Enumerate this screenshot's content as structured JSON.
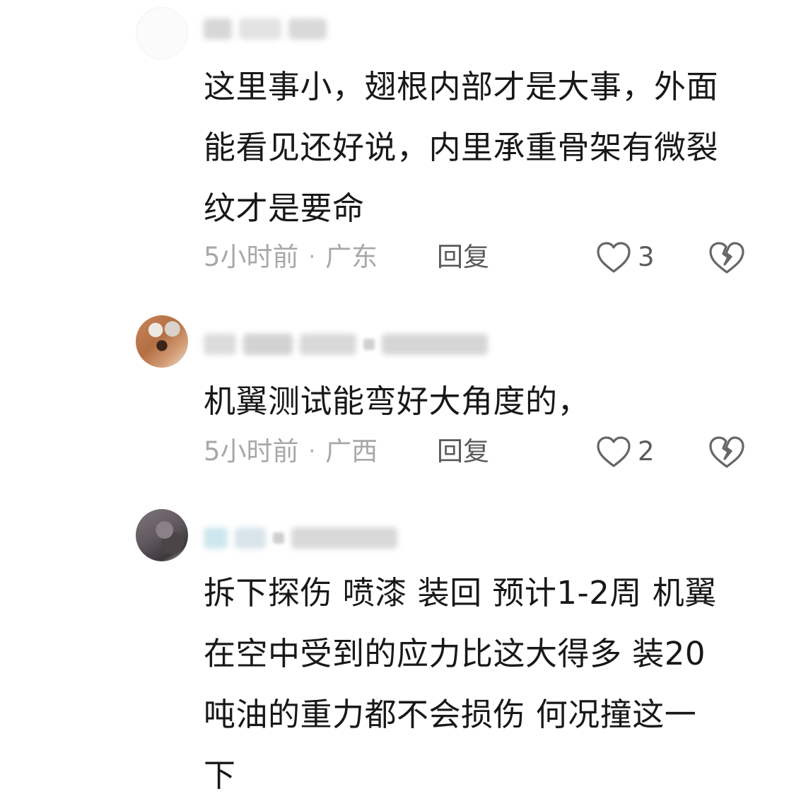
{
  "comments": [
    {
      "avatar": "blank-avatar",
      "text": "这里事小，翅根内部才是大事，外面能看见还好说，内里承重骨架有微裂纹才是要命",
      "lines": [
        "这里事小，翅根内部才是大事，外面",
        "能看见还好说，内里承重骨架有微裂",
        "纹才是要命"
      ],
      "time": "5小时前",
      "separator": "·",
      "location": "广东",
      "reply_label": "回复",
      "like_icon": "heart-outline-icon",
      "likes": "3",
      "dislike_icon": "broken-heart-icon"
    },
    {
      "avatar": "photo-avatar",
      "lines": [
        "机翼测试能弯好大角度的，"
      ],
      "time": "5小时前",
      "separator": "·",
      "location": "广西",
      "reply_label": "回复",
      "like_icon": "heart-outline-icon",
      "likes": "2",
      "dislike_icon": "broken-heart-icon"
    },
    {
      "avatar": "photo-avatar",
      "lines": [
        "拆下探伤 喷漆 装回 预计1-2周 机翼",
        "在空中受到的应力比这大得多 装20",
        "吨油的重力都不会损伤 何况撞这一",
        "下"
      ]
    }
  ],
  "colors": {
    "text_primary": "#181818",
    "text_meta": "#a8a8a8",
    "text_action": "#5a5a5a",
    "background": "#ffffff"
  }
}
